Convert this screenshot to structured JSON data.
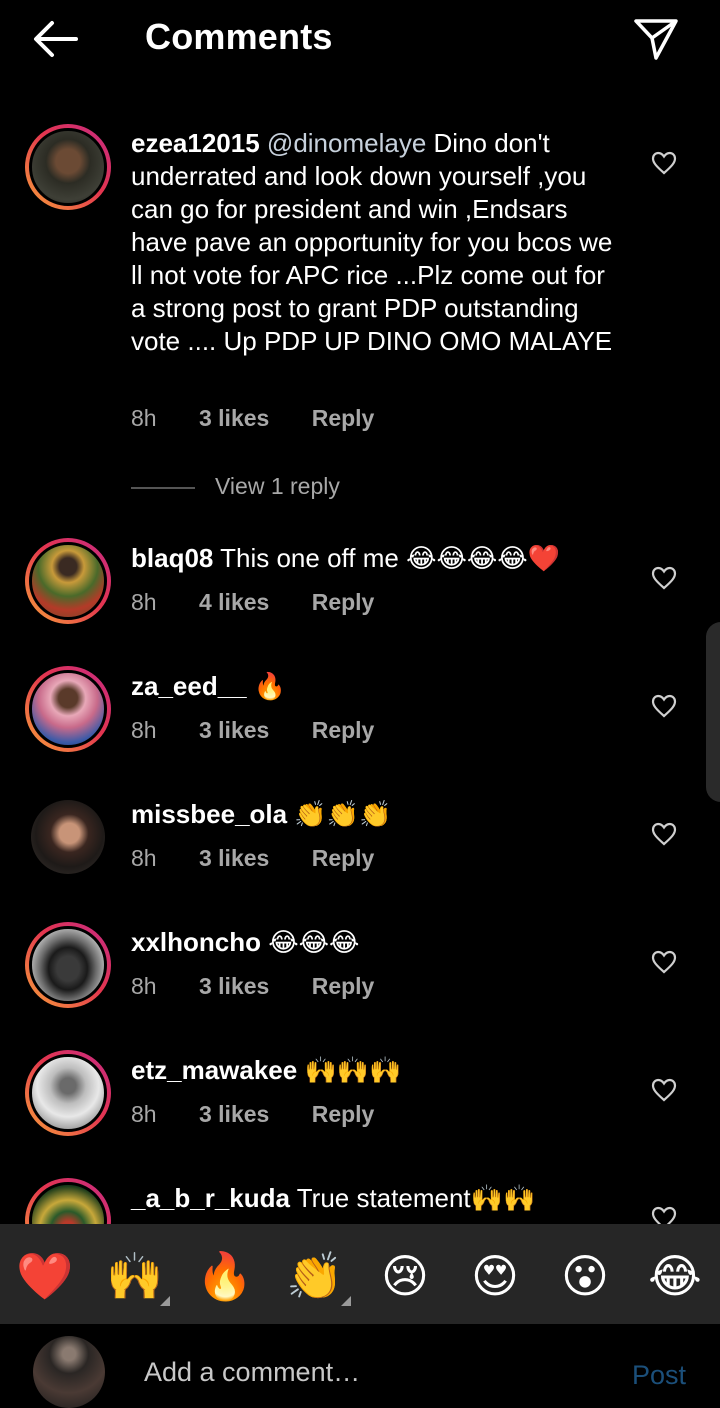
{
  "header": {
    "title": "Comments"
  },
  "comments": [
    {
      "username": "ezea12015",
      "mention": "@dinomelaye",
      "text": " Dino don't underrated and look down yourself ,you can go for president and win ,Endsars have pave an opportunity for you bcos we ll not vote for APC rice ...Plz come out for a strong post to grant PDP outstanding vote .... Up PDP UP DINO OMO MALAYE",
      "time": "8h",
      "likes": "3 likes",
      "reply": "Reply"
    },
    {
      "username": "blaq08",
      "text": " This one off me 😂😂😂😂❤️",
      "time": "8h",
      "likes": "4 likes",
      "reply": "Reply"
    },
    {
      "username": "za_eed__",
      "text": " 🔥",
      "time": "8h",
      "likes": "3 likes",
      "reply": "Reply"
    },
    {
      "username": "missbee_ola",
      "text": " 👏👏👏",
      "time": "8h",
      "likes": "3 likes",
      "reply": "Reply"
    },
    {
      "username": "xxlhoncho",
      "text": " 😂😂😂",
      "time": "8h",
      "likes": "3 likes",
      "reply": "Reply"
    },
    {
      "username": "etz_mawakee",
      "text": " 🙌🙌🙌",
      "time": "8h",
      "likes": "3 likes",
      "reply": "Reply"
    },
    {
      "username": "_a_b_r_kuda",
      "text": " True statement🙌🙌"
    }
  ],
  "view_reply": "View 1 reply",
  "emoji_bar": [
    "❤️",
    "🙌",
    "🔥",
    "👏",
    "😢",
    "😍",
    "😮",
    "😂"
  ],
  "bottom": {
    "placeholder": "Add a comment…",
    "post_label": "Post"
  },
  "colors": {
    "accent_post": "#1b4f7a",
    "meta_gray": "#a8a8a8",
    "bar_bg": "#262626"
  },
  "icons": [
    "back-arrow-icon",
    "send-icon",
    "heart-outline-icon"
  ]
}
